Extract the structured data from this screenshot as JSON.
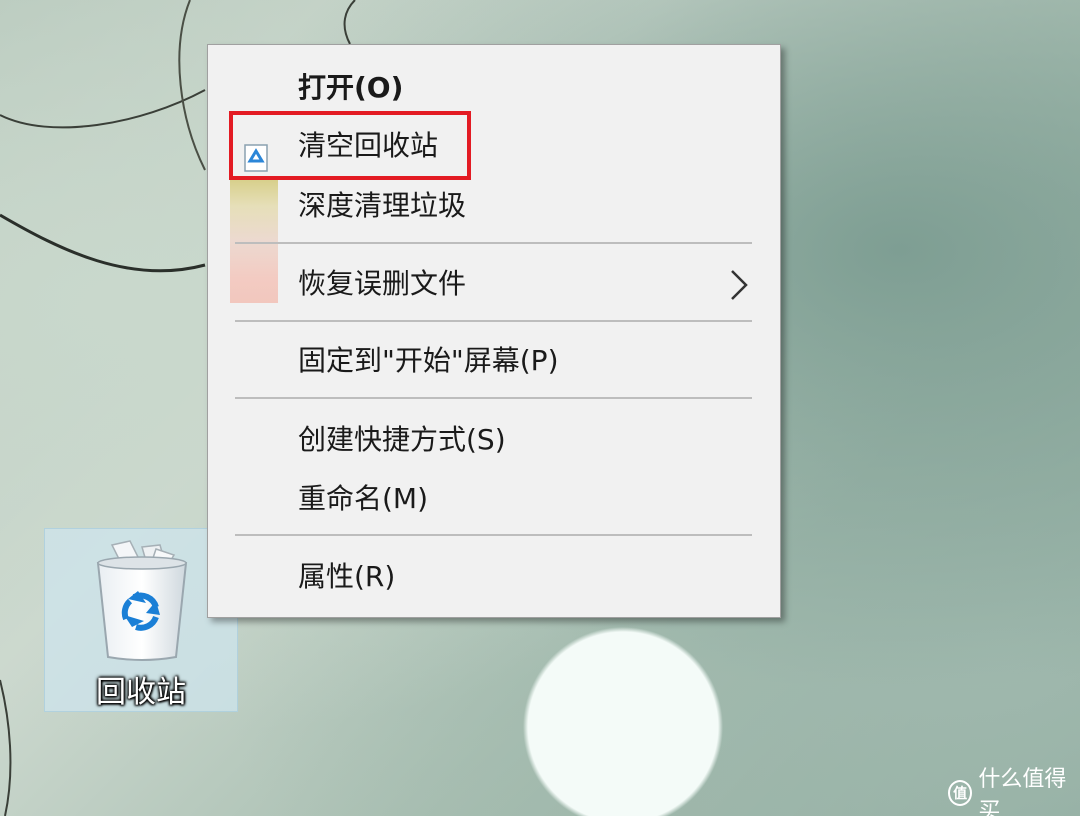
{
  "desktop": {
    "recycle_bin_label": "回收站"
  },
  "context_menu": {
    "items": [
      {
        "label": "打开(O)",
        "bold": true
      },
      {
        "label": "清空回收站",
        "icon": "recycle-bin-empty-icon",
        "highlighted": true
      },
      {
        "label": "深度清理垃圾"
      },
      {
        "label": "恢复误删文件",
        "submenu": true
      },
      {
        "label": "固定到\"开始\"屏幕(P)"
      },
      {
        "label": "创建快捷方式(S)"
      },
      {
        "label": "重命名(M)"
      },
      {
        "label": "属性(R)"
      }
    ]
  },
  "watermark": {
    "logo_text": "值",
    "text": "什么值得买"
  },
  "colors": {
    "highlight": "#e31b23",
    "menu_background": "#f1f1f1",
    "separator": "#bdbdbd"
  }
}
